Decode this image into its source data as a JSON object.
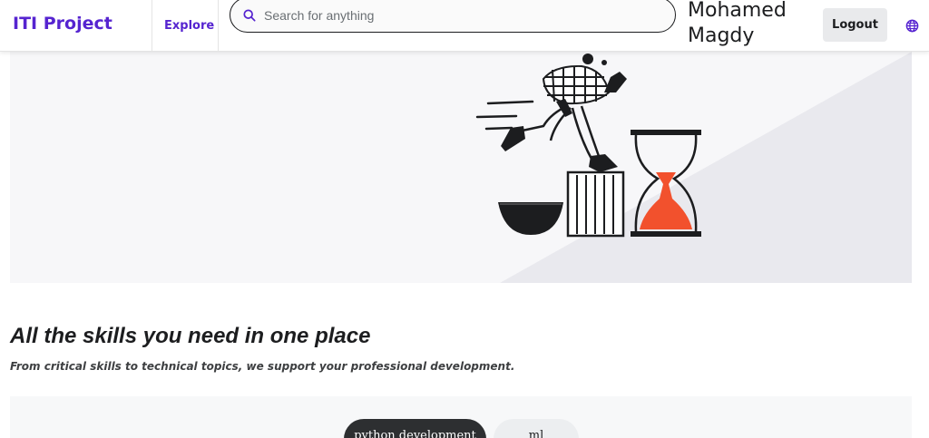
{
  "header": {
    "brand": "ITI Project",
    "explore_label": "Explore",
    "search_placeholder": "Search for anything",
    "user_line1": "Mohamed",
    "user_line2": "Magdy",
    "logout_label": "Logout",
    "accent_color": "#5624d0"
  },
  "hero": {
    "illustration": "runner-hourglass-illustration",
    "accent_color": "#f2512d"
  },
  "section": {
    "title": "All the skills you need in one place",
    "subtitle": "From critical skills to technical topics, we support your professional development."
  },
  "tabs": [
    {
      "label": "python development",
      "active": true
    },
    {
      "label": "ml",
      "active": false
    }
  ]
}
